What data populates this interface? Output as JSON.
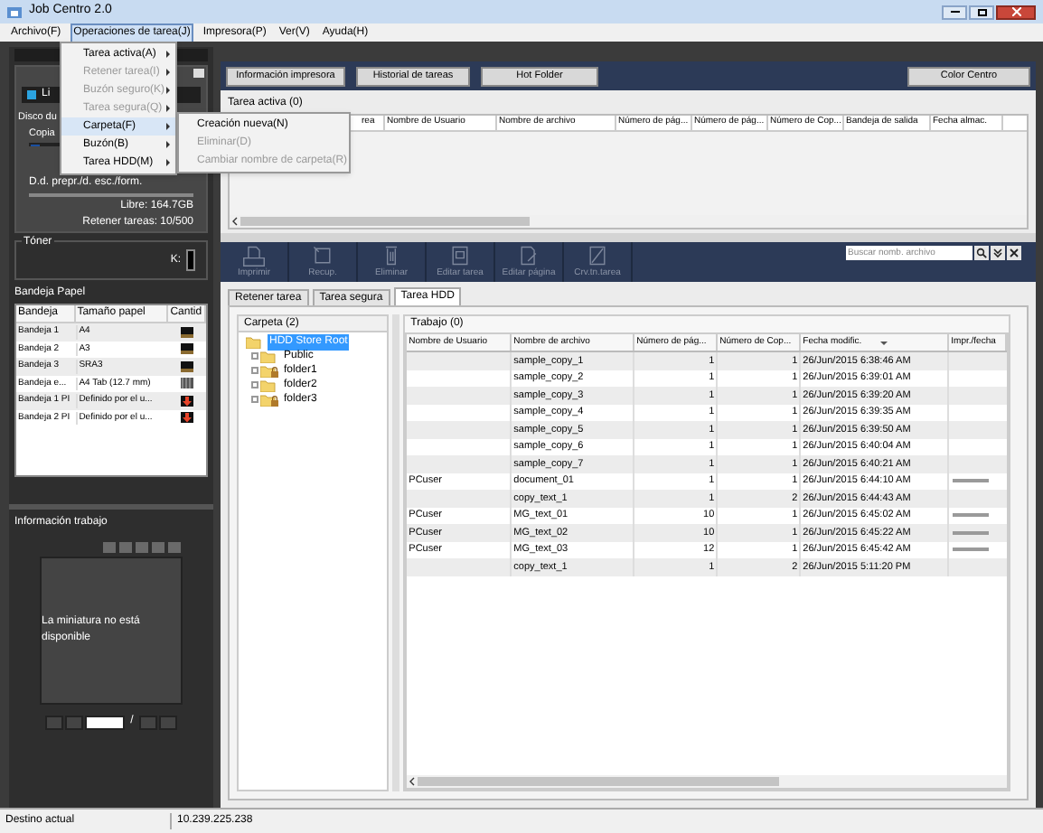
{
  "window": {
    "title": "Job Centro 2.0"
  },
  "menu_bar": [
    {
      "label": "Archivo(F)",
      "selected": false
    },
    {
      "label": "Operaciones de tarea(J)",
      "selected": true
    },
    {
      "label": "Impresora(P)",
      "selected": false
    },
    {
      "label": "Ver(V)",
      "selected": false
    },
    {
      "label": "Ayuda(H)",
      "selected": false
    }
  ],
  "menu": [
    {
      "label": "Tarea activa(A)",
      "disabled": false,
      "selected": false
    },
    {
      "label": "Retener tarea(I)",
      "disabled": true,
      "selected": false
    },
    {
      "label": "Buzón seguro(K)",
      "disabled": true,
      "selected": false
    },
    {
      "label": "Tarea segura(Q)",
      "disabled": true,
      "selected": false
    },
    {
      "label": "Carpeta(F)",
      "disabled": false,
      "selected": true
    },
    {
      "label": "Buzón(B)",
      "disabled": false,
      "selected": false
    },
    {
      "label": "Tarea HDD(M)",
      "disabled": false,
      "selected": false
    }
  ],
  "submenu": [
    {
      "label": "Creación nueva(N)",
      "disabled": false
    },
    {
      "label": "Eliminar(D)",
      "disabled": true
    },
    {
      "label": "Cambiar nombre de carpeta(R)",
      "disabled": true
    }
  ],
  "device": {
    "name": "Li",
    "disk_label": "Disco du",
    "copy_label": "Copia",
    "field_label": "D.d. prepr./d. esc./form.",
    "free": "Libre: 164.7GB",
    "retained": "Retener tareas: 10/500"
  },
  "toner": {
    "label": "Tóner",
    "channels": [
      {
        "name": "K:",
        "level": 1
      }
    ]
  },
  "paper_trays": {
    "title": "Bandeja Papel",
    "columns": [
      "Bandeja",
      "Tamaño papel",
      "Cantid"
    ],
    "rows": [
      {
        "tray": "Bandeja 1",
        "size": "A4",
        "kind": "full"
      },
      {
        "tray": "Bandeja 2",
        "size": "A3",
        "kind": "full"
      },
      {
        "tray": "Bandeja 3",
        "size": "SRA3",
        "kind": "full"
      },
      {
        "tray": "Bandeja e...",
        "size": "A4 Tab (12.7 mm)",
        "kind": "tab"
      },
      {
        "tray": "Bandeja 1 PI",
        "size": "Definido por el u...",
        "kind": "empty"
      },
      {
        "tray": "Bandeja 2 PI",
        "size": "Definido por el u...",
        "kind": "empty"
      }
    ]
  },
  "job_info": {
    "title": "Información trabajo",
    "thumbnail_text": "La miniatura no está disponible",
    "page_separator": "/"
  },
  "top_buttons": [
    "Información impresora",
    "Historial de tareas",
    "Hot Folder",
    "Color Centro"
  ],
  "active_jobs": {
    "title": "Tarea activa (0)",
    "columns": [
      "rea",
      "Nombre de Usuario",
      "Nombre de archivo",
      "Número de pág...",
      "Número de pág...",
      "Número de Cop...",
      "Bandeja de salida",
      "Fecha almac."
    ]
  },
  "toolbar": [
    {
      "label": "Imprimir",
      "kind": "print"
    },
    {
      "label": "Recup.",
      "kind": "recover"
    },
    {
      "label": "Eliminar",
      "kind": "delete"
    },
    {
      "label": "Editar tarea",
      "kind": "edit-job"
    },
    {
      "label": "Editar página",
      "kind": "edit-page"
    },
    {
      "label": "Crv.tn.tarea",
      "kind": "thumbnail"
    }
  ],
  "search": {
    "placeholder": "Buscar nomb. archivo"
  },
  "tabs": [
    {
      "label": "Retener tarea",
      "selected": false
    },
    {
      "label": "Tarea segura",
      "selected": false
    },
    {
      "label": "Tarea HDD",
      "selected": true
    }
  ],
  "folder_tree": {
    "title": "Carpeta (2)",
    "items": [
      {
        "label": "HDD Store Root",
        "selected": true,
        "locked": false,
        "children": [
          {
            "label": "Public",
            "selected": false,
            "locked": false
          },
          {
            "label": "folder1",
            "selected": false,
            "locked": true
          },
          {
            "label": "folder2",
            "selected": false,
            "locked": false
          },
          {
            "label": "folder3",
            "selected": false,
            "locked": true
          }
        ]
      }
    ]
  },
  "jobs": {
    "title": "Trabajo (0)",
    "columns": [
      "Nombre de Usuario",
      "Nombre de archivo",
      "Número de pág...",
      "Número de Cop...",
      "Fecha modific.",
      "Impr./fecha"
    ],
    "rows": [
      {
        "file": "sample_copy_1",
        "pages": "1",
        "copies": "1",
        "date": "26/Jun/2015 6:38:46 AM",
        "printed": false
      },
      {
        "file": "sample_copy_2",
        "pages": "1",
        "copies": "1",
        "date": "26/Jun/2015 6:39:01 AM",
        "printed": false
      },
      {
        "file": "sample_copy_3",
        "pages": "1",
        "copies": "1",
        "date": "26/Jun/2015 6:39:20 AM",
        "printed": false
      },
      {
        "file": "sample_copy_4",
        "pages": "1",
        "copies": "1",
        "date": "26/Jun/2015 6:39:35 AM",
        "printed": false
      },
      {
        "file": "sample_copy_5",
        "pages": "1",
        "copies": "1",
        "date": "26/Jun/2015 6:39:50 AM",
        "printed": false
      },
      {
        "file": "sample_copy_6",
        "pages": "1",
        "copies": "1",
        "date": "26/Jun/2015 6:40:04 AM",
        "printed": false
      },
      {
        "file": "sample_copy_7",
        "pages": "1",
        "copies": "1",
        "date": "26/Jun/2015 6:40:21 AM",
        "printed": false
      },
      {
        "user": "PCuser",
        "file": "document_01",
        "pages": "1",
        "copies": "1",
        "date": "26/Jun/2015 6:44:10 AM",
        "printed": true
      },
      {
        "file": "copy_text_1",
        "pages": "1",
        "copies": "2",
        "date": "26/Jun/2015 6:44:43 AM",
        "printed": false
      },
      {
        "user": "PCuser",
        "file": "MG_text_01",
        "pages": "10",
        "copies": "1",
        "date": "26/Jun/2015 6:45:02 AM",
        "printed": true
      },
      {
        "user": "PCuser",
        "file": "MG_text_02",
        "pages": "10",
        "copies": "1",
        "date": "26/Jun/2015 6:45:22 AM",
        "printed": true
      },
      {
        "user": "PCuser",
        "file": "MG_text_03",
        "pages": "12",
        "copies": "1",
        "date": "26/Jun/2015 6:45:42 AM",
        "printed": true
      },
      {
        "file": "copy_text_1",
        "pages": "1",
        "copies": "2",
        "date": "26/Jun/2015 5:11:20 PM",
        "printed": false
      }
    ]
  },
  "status_bar": [
    "Destino actual",
    "10.239.225.238"
  ]
}
